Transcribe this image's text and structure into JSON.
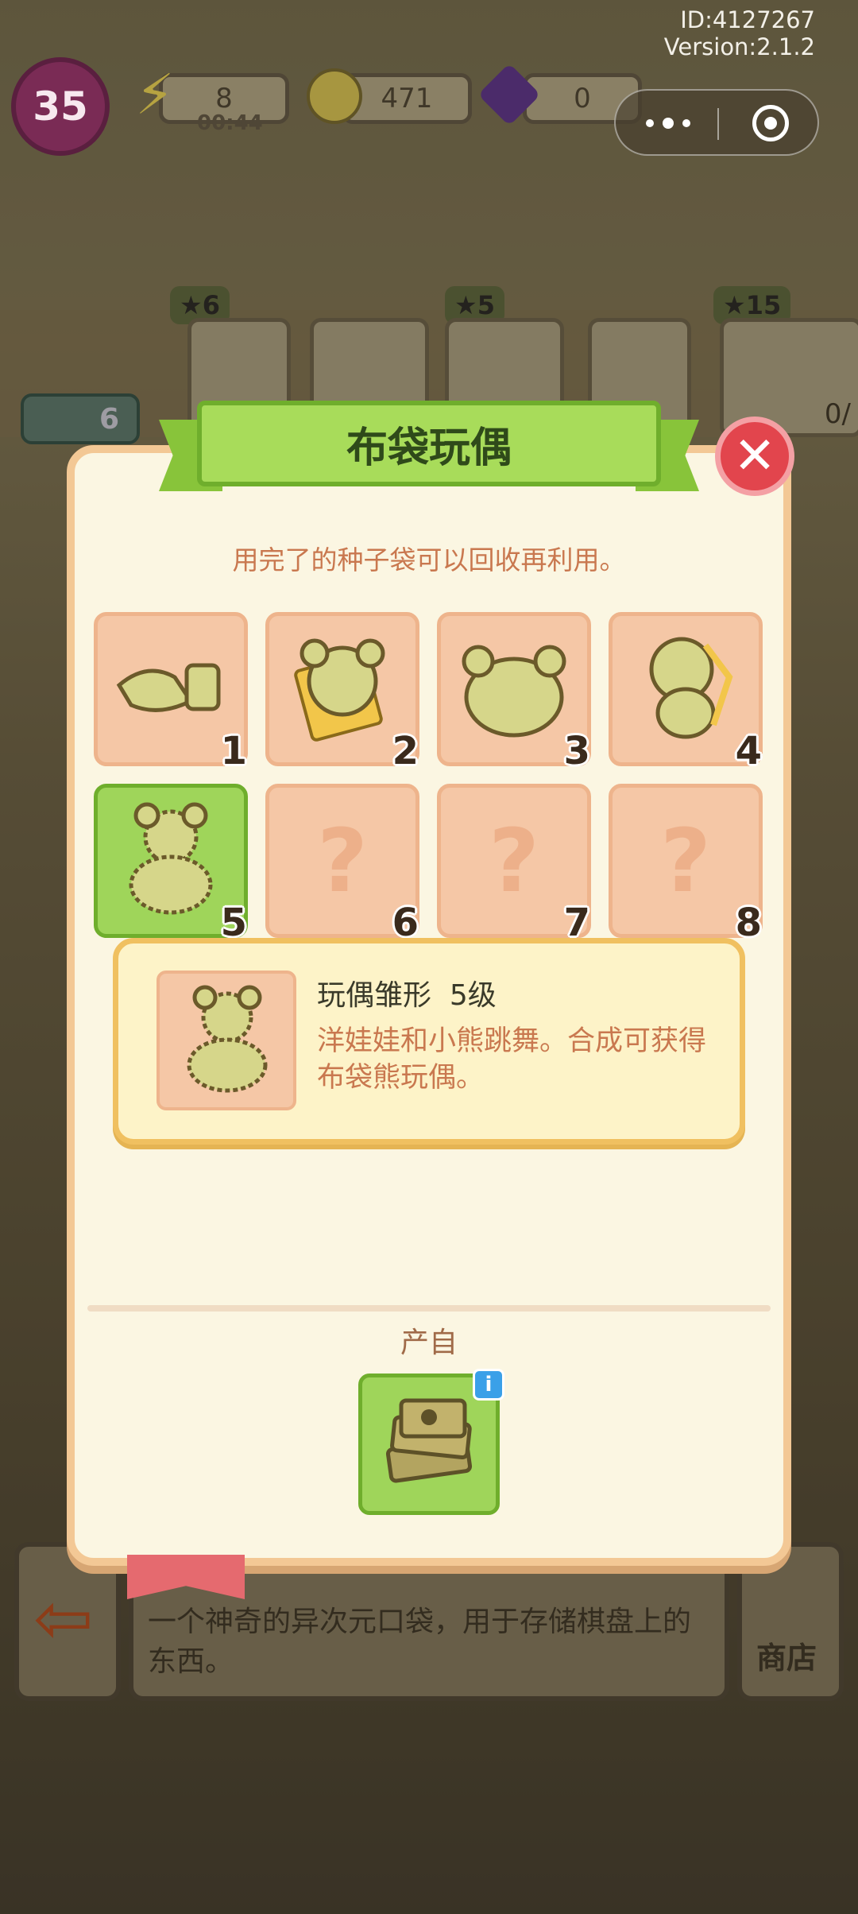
{
  "status": {
    "id_text": "ID:4127267",
    "version_text": "Version:2.1.2"
  },
  "hud": {
    "level": "35",
    "energy": "8",
    "energy_timer": "00:44",
    "coins": "471",
    "gems": "0"
  },
  "orders": {
    "chips": [
      "6",
      "5",
      "15"
    ],
    "chicken_count": "6",
    "partial_text": "0/"
  },
  "modal": {
    "title": "布袋玩偶",
    "hint": "用完了的种子袋可以回收再利用。",
    "stages": [
      {
        "num": "1",
        "icon": "cloth-roll-icon",
        "unlocked": true
      },
      {
        "num": "2",
        "icon": "cut-bear-pattern-icon",
        "unlocked": true
      },
      {
        "num": "3",
        "icon": "bear-head-icon",
        "unlocked": true
      },
      {
        "num": "4",
        "icon": "sewing-bear-icon",
        "unlocked": true
      },
      {
        "num": "5",
        "icon": "bear-doll-prototype-icon",
        "unlocked": true,
        "selected": true
      },
      {
        "num": "6",
        "icon": "locked-question-icon",
        "unlocked": false
      },
      {
        "num": "7",
        "icon": "locked-question-icon",
        "unlocked": false
      },
      {
        "num": "8",
        "icon": "locked-question-icon",
        "unlocked": false
      }
    ],
    "locked_glyph": "?",
    "detail": {
      "title": "玩偶雏形  5级",
      "description": "洋娃娃和小熊跳舞。合成可获得布袋熊玩偶。"
    },
    "source_label": "产自",
    "source_icon": "seed-bag-stack-icon",
    "info_glyph": "i",
    "close_glyph": "✕"
  },
  "bottom": {
    "description": "一个神奇的异次元口袋，用于存储棋盘上的东西。",
    "shop_label": "商店"
  },
  "colors": {
    "accent_green": "#9fd55a",
    "close_red": "#e2454d",
    "tile_peach": "#f5c7a6",
    "hint_text": "#c9784f"
  }
}
